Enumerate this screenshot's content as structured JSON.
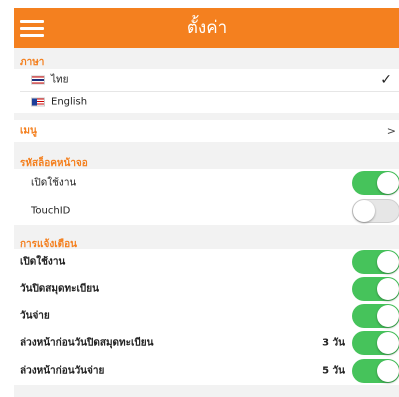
{
  "header": {
    "title": "ตั้งค่า"
  },
  "language": {
    "section_title": "ภาษา",
    "options": [
      {
        "label": "ไทย",
        "flag": "thai-flag-icon",
        "selected": true
      },
      {
        "label": "English",
        "flag": "us-flag-icon",
        "selected": false
      }
    ],
    "selected_mark": "✓"
  },
  "menu": {
    "label": "เมนู",
    "chevron": ">"
  },
  "screen_lock": {
    "section_title": "รหัสล็อคหน้าจอ",
    "enable_label": "เปิดใช้งาน",
    "enable_on": true,
    "touchid_label": "TouchID",
    "touchid_on": false
  },
  "notifications": {
    "section_title": "การแจ้งเตือน",
    "items": [
      {
        "label": "เปิดใช้งาน",
        "on": true
      },
      {
        "label": "วันปิดสมุดทะเบียน",
        "on": true
      },
      {
        "label": "วันจ่าย",
        "on": true
      },
      {
        "label": "ล่วงหน้าก่อนวันปิดสมุดทะเบียน",
        "days": "3 วัน",
        "on": true
      },
      {
        "label": "ล่วงหน้าก่อนวันจ่าย",
        "days": "5 วัน",
        "on": true
      }
    ]
  },
  "colors": {
    "accent": "#f4801f",
    "toggle_on": "#46c35b",
    "toggle_off": "#e6e6e6"
  }
}
